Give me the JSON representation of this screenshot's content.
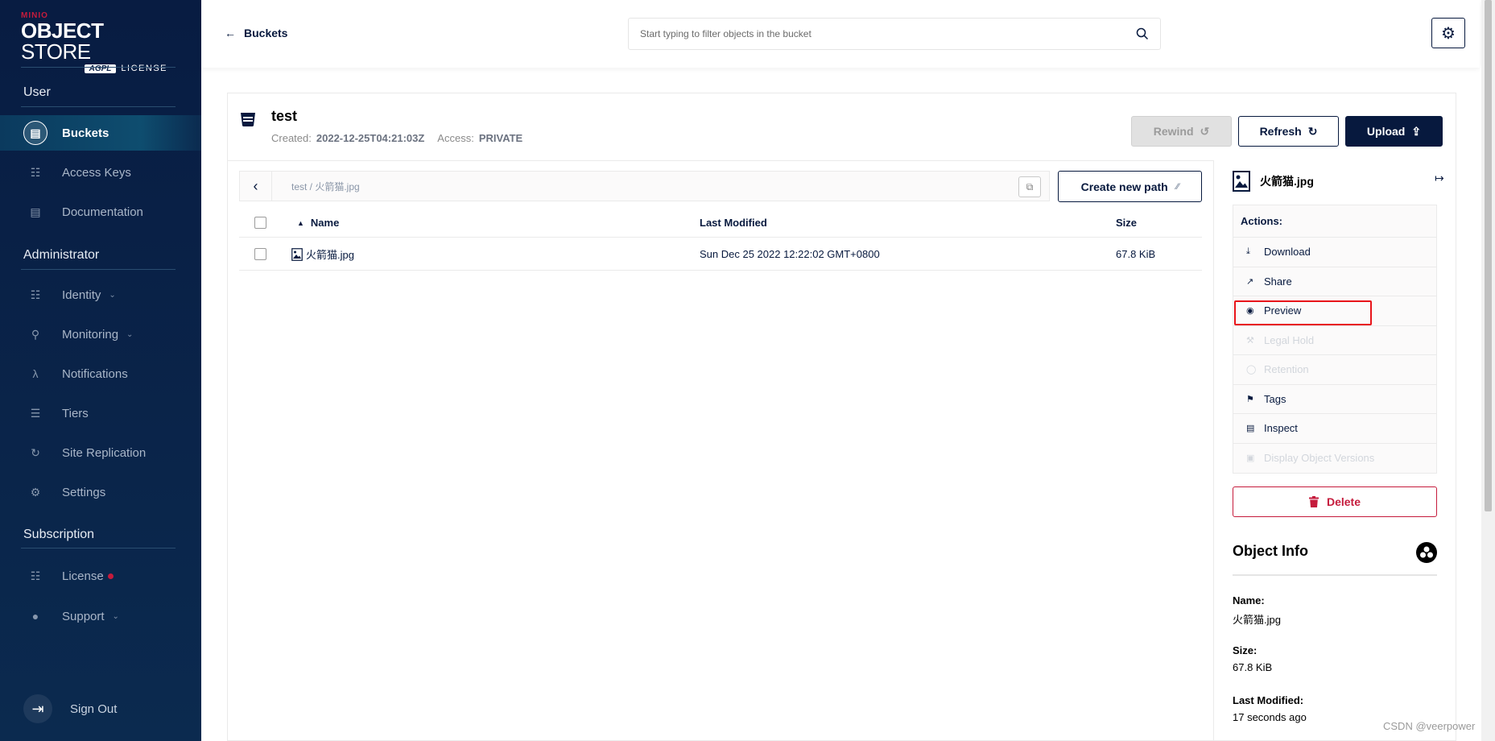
{
  "sidebar": {
    "logo": {
      "brand": "MINIO",
      "product_bold": "OBJECT",
      "product_light": "STORE",
      "badge": "AGPL",
      "license": "LICENSE"
    },
    "sections": {
      "user": "User",
      "admin": "Administrator",
      "subscription": "Subscription"
    },
    "items": {
      "buckets": "Buckets",
      "access_keys": "Access Keys",
      "documentation": "Documentation",
      "identity": "Identity",
      "monitoring": "Monitoring",
      "notifications": "Notifications",
      "tiers": "Tiers",
      "site_replication": "Site Replication",
      "settings": "Settings",
      "license": "License",
      "support": "Support"
    },
    "sign_out": "Sign Out"
  },
  "header": {
    "back_label": "Buckets",
    "search_placeholder": "Start typing to filter objects in the bucket"
  },
  "bucket": {
    "name": "test",
    "created_label": "Created:",
    "created_value": "2022-12-25T04:21:03Z",
    "access_label": "Access:",
    "access_value": "PRIVATE"
  },
  "toolbar": {
    "rewind": "Rewind",
    "refresh": "Refresh",
    "upload": "Upload"
  },
  "browser": {
    "path": "test / 火箭猫.jpg",
    "create_path": "Create new path",
    "columns": {
      "name": "Name",
      "modified": "Last Modified",
      "size": "Size"
    },
    "rows": [
      {
        "name": "火箭猫.jpg",
        "modified": "Sun Dec 25 2022 12:22:02 GMT+0800",
        "size": "67.8 KiB"
      }
    ]
  },
  "details": {
    "object_name": "火箭猫.jpg",
    "actions_label": "Actions:",
    "actions": {
      "download": "Download",
      "share": "Share",
      "preview": "Preview",
      "legal_hold": "Legal Hold",
      "retention": "Retention",
      "tags": "Tags",
      "inspect": "Inspect",
      "versions": "Display Object Versions"
    },
    "delete": "Delete",
    "info_title": "Object Info",
    "info": {
      "name_label": "Name:",
      "name_value": "火箭猫.jpg",
      "size_label": "Size:",
      "size_value": "67.8 KiB",
      "modified_label": "Last Modified:",
      "modified_value": "17 seconds ago"
    }
  },
  "watermark": "CSDN @veerpower",
  "colors": {
    "navy": "#07193e",
    "danger": "#c51b3c",
    "highlight": "#e8141a"
  }
}
